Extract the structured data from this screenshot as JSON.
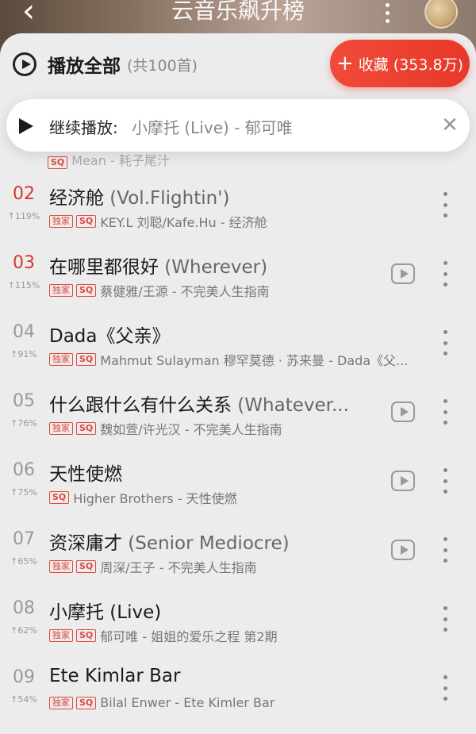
{
  "header": {
    "back_icon": "chevron-left-icon",
    "title": "云音乐飙升榜",
    "more_icon": "more-vertical-icon"
  },
  "playall": {
    "label": "播放全部",
    "count": "(共100首)",
    "collect_label": "收藏 (353.8万)"
  },
  "continue": {
    "label": "继续播放:",
    "song": "小摩托 (Live) - 郁可唯"
  },
  "peek": {
    "text": "Mean - 耗子尾汁"
  },
  "colors": {
    "accent": "#e8382a",
    "rank_top": "#d33a2e",
    "badge": "#e04a3e"
  },
  "songs": [
    {
      "rank": "02",
      "trend": "119%",
      "title": "经济舱",
      "sub": " (Vol.Flightin')",
      "exclusive": true,
      "meta": "KEY.L 刘聪/Kafe.Hu - 经济舱",
      "mv": false
    },
    {
      "rank": "03",
      "trend": "115%",
      "title": "在哪里都很好",
      "sub": " (Wherever)",
      "exclusive": true,
      "meta": "蔡健雅/王源 - 不完美人生指南",
      "mv": true
    },
    {
      "rank": "04",
      "trend": "91%",
      "title": "Dada《父亲》",
      "sub": "",
      "exclusive": true,
      "meta": "Mahmut Sulayman 穆罕莫德 · 苏来曼 - Dada《父...",
      "mv": false
    },
    {
      "rank": "05",
      "trend": "76%",
      "title": "什么跟什么有什么关系",
      "sub": " (Whatever...",
      "exclusive": true,
      "meta": "魏如萱/许光汉 - 不完美人生指南",
      "mv": true
    },
    {
      "rank": "06",
      "trend": "75%",
      "title": "天性使燃",
      "sub": "",
      "exclusive": false,
      "meta": "Higher Brothers - 天性使燃",
      "mv": true
    },
    {
      "rank": "07",
      "trend": "65%",
      "title": "资深庸才",
      "sub": " (Senior Mediocre)",
      "exclusive": true,
      "meta": "周深/王子 - 不完美人生指南",
      "mv": true
    },
    {
      "rank": "08",
      "trend": "62%",
      "title": "小摩托 (Live)",
      "sub": "",
      "exclusive": true,
      "meta": "郁可唯 - 姐姐的爱乐之程 第2期",
      "mv": false
    },
    {
      "rank": "09",
      "trend": "54%",
      "title": "Ete Kimlar Bar",
      "sub": "",
      "exclusive": true,
      "meta": "Bilal Enwer - Ete Kimler Bar",
      "mv": false
    }
  ],
  "labels": {
    "exclusive": "独家",
    "sq": "SQ",
    "trend_arrow": "↑"
  }
}
